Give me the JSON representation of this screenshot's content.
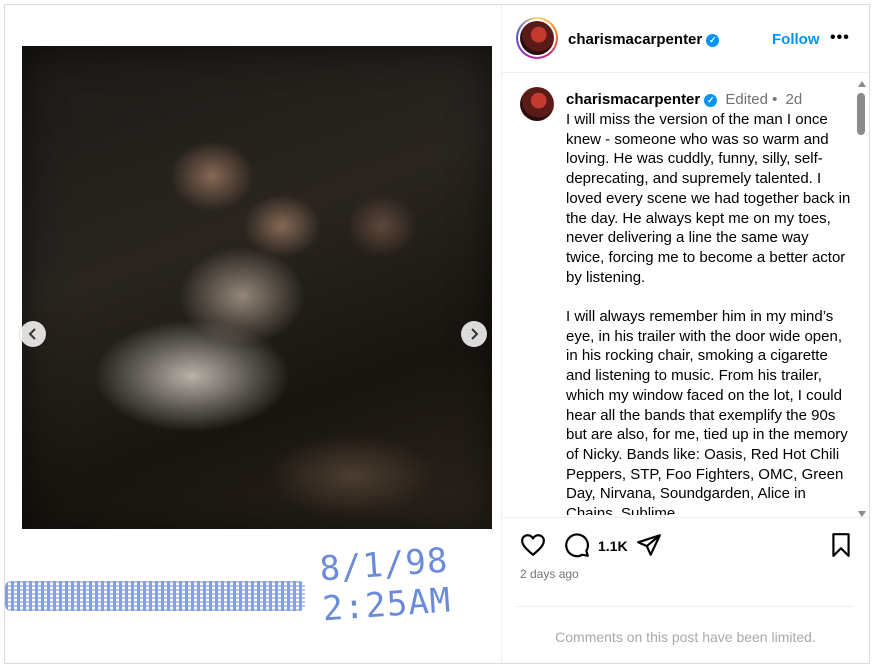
{
  "post": {
    "handwritten_date": "8/1/98",
    "handwritten_time": "2:25AM"
  },
  "header": {
    "username": "charismacarpenter",
    "follow_label": "Follow",
    "more_label": "•••"
  },
  "caption": {
    "username": "charismacarpenter",
    "edited_label": "Edited •",
    "age": "2d",
    "text": "I will miss the version of the man I once knew - someone who was so warm and loving. He was cuddly, funny, silly, self-deprecating, and supremely talented. I loved every scene we had together back in the day. He always kept me on my toes, never delivering a line the same way twice, forcing me to become a better actor by listening.\n\nI will always remember him in my mind’s eye, in his trailer with the door wide open, in his rocking chair, smoking a cigarette and listening to music. From his trailer, which my window faced on the lot, I could hear all the bands that exemplify the 90s but are also, for me, tied up in the memory of Nicky. Bands like: Oasis, Red Hot Chili Peppers, STP, Foo Fighters, OMC, Green Day, Nirvana, Soundgarden, Alice in Chains, Sublime"
  },
  "actions": {
    "comment_count": "1.1K"
  },
  "footer": {
    "date": "2 days ago",
    "comments_limited": "Comments on this post have been limited."
  },
  "icons": {
    "verified": "verified-badge-icon",
    "like": "heart-icon",
    "comment": "speech-bubble-icon",
    "share": "paper-plane-icon",
    "save": "bookmark-icon",
    "prev": "chevron-left-icon",
    "next": "chevron-right-icon"
  },
  "colors": {
    "link": "#0095f6",
    "muted": "#737373",
    "border": "#dbdbdb",
    "handwriting": "#5c7fd6"
  }
}
